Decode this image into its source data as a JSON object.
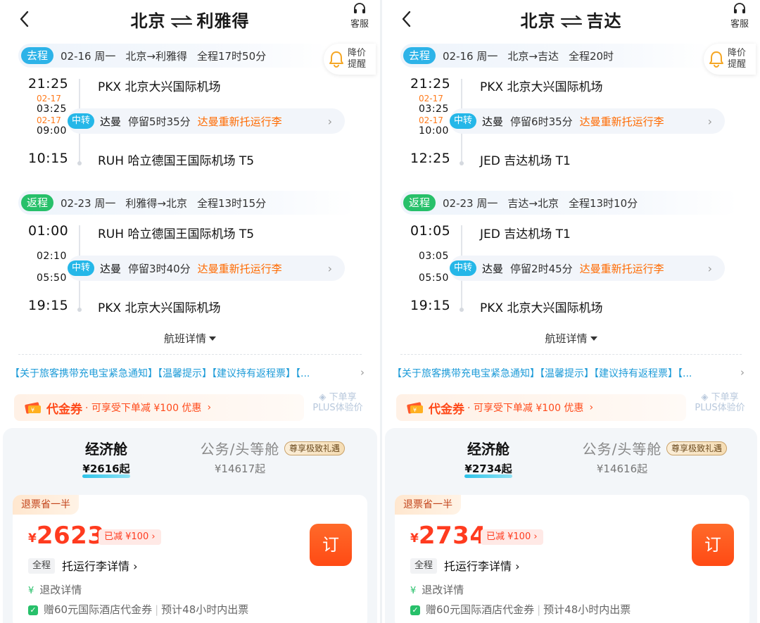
{
  "panels": [
    {
      "header": {
        "from": "北京",
        "to": "利雅得",
        "service_label": "客服"
      },
      "alert": {
        "label_line1": "降价",
        "label_line2": "提醒"
      },
      "outbound": {
        "tag": "去程",
        "date": "02-16 周一",
        "route": "北京→利雅得",
        "duration": "全程17时50分",
        "dep_time": "21:25",
        "dep_airport": "PKX 北京大兴国际机场",
        "arr1_date": "02-17",
        "arr1_time": "03:25",
        "dep2_date": "02-17",
        "dep2_time": "09:00",
        "arr_time": "10:15",
        "arr_airport": "RUH 哈立德国王国际机场 T5",
        "transfer": {
          "tag": "中转",
          "city": "达曼",
          "stay": "停留5时35分",
          "baggage": "达曼重新托运行李"
        }
      },
      "return": {
        "tag": "返程",
        "date": "02-23 周一",
        "route": "利雅得→北京",
        "duration": "全程13时15分",
        "dep_time": "01:00",
        "dep_airport": "RUH 哈立德国王国际机场 T5",
        "arr1_time": "02:10",
        "dep2_time": "05:50",
        "arr_time": "19:15",
        "arr_airport": "PKX 北京大兴国际机场",
        "transfer": {
          "tag": "中转",
          "city": "达曼",
          "stay": "停留3时40分",
          "baggage": "达曼重新托运行李"
        }
      },
      "flight_details": "航班详情",
      "notice": "【关于旅客携带充电宝紧急通知】【温馨提示】【建议持有返程票】【...",
      "coupon": {
        "name": "代金券",
        "desc": "· 可享受下单减 ¥100 优惠"
      },
      "plus": {
        "line1": "下单享",
        "line2": "PLUS体验价"
      },
      "cabins": {
        "economy": {
          "name": "经济舱",
          "price": "¥2616起"
        },
        "business": {
          "name": "公务/头等舱",
          "price": "¥14617起",
          "tag": "尊享极致礼遇"
        }
      },
      "offer": {
        "tag": "退票省一半",
        "currency": "¥",
        "price": "2623",
        "discount": "已减 ¥100",
        "book": "订",
        "whole_trip": "全程",
        "baggage_details": "托运行李详情",
        "refund_details": "退改详情",
        "hotel_voucher": "赠60元国际酒店代金券",
        "ticketing": "预计48小时内出票"
      }
    },
    {
      "header": {
        "from": "北京",
        "to": "吉达",
        "service_label": "客服"
      },
      "alert": {
        "label_line1": "降价",
        "label_line2": "提醒"
      },
      "outbound": {
        "tag": "去程",
        "date": "02-16 周一",
        "route": "北京→吉达",
        "duration": "全程20时",
        "dep_time": "21:25",
        "dep_airport": "PKX 北京大兴国际机场",
        "arr1_date": "02-17",
        "arr1_time": "03:25",
        "dep2_date": "02-17",
        "dep2_time": "10:00",
        "arr_time": "12:25",
        "arr_airport": "JED 吉达机场 T1",
        "transfer": {
          "tag": "中转",
          "city": "达曼",
          "stay": "停留6时35分",
          "baggage": "达曼重新托运行李"
        }
      },
      "return": {
        "tag": "返程",
        "date": "02-23 周一",
        "route": "吉达→北京",
        "duration": "全程13时10分",
        "dep_time": "01:05",
        "dep_airport": "JED 吉达机场 T1",
        "arr1_time": "03:05",
        "dep2_time": "05:50",
        "arr_time": "19:15",
        "arr_airport": "PKX 北京大兴国际机场",
        "transfer": {
          "tag": "中转",
          "city": "达曼",
          "stay": "停留2时45分",
          "baggage": "达曼重新托运行李"
        }
      },
      "flight_details": "航班详情",
      "notice": "【关于旅客携带充电宝紧急通知】【温馨提示】【建议持有返程票】【...",
      "coupon": {
        "name": "代金券",
        "desc": "· 可享受下单减 ¥100 优惠"
      },
      "plus": {
        "line1": "下单享",
        "line2": "PLUS体验价"
      },
      "cabins": {
        "economy": {
          "name": "经济舱",
          "price": "¥2734起"
        },
        "business": {
          "name": "公务/头等舱",
          "price": "¥14616起",
          "tag": "尊享极致礼遇"
        }
      },
      "offer": {
        "tag": "退票省一半",
        "currency": "¥",
        "price": "2734",
        "discount": "已减 ¥100",
        "book": "订",
        "whole_trip": "全程",
        "baggage_details": "托运行李详情",
        "refund_details": "退改详情",
        "hotel_voucher": "赠60元国际酒店代金券",
        "ticketing": "预计48小时内出票"
      }
    }
  ],
  "colors": {
    "outbound_tag": "#2db3e8",
    "return_tag": "#27c06a",
    "transfer_tag": "#25b7e8",
    "baggage_notice": "#ff6a00",
    "price": "#ff3b1f",
    "book_button": "#ff4a14",
    "notice_link": "#1d9bd8"
  },
  "icons": [
    "back-chevron-icon",
    "swap-arrows-icon",
    "headset-icon",
    "bell-icon",
    "chevron-right-icon",
    "dropdown-triangle-icon",
    "coupon-ticket-icon",
    "plus-badge-icon",
    "yen-icon",
    "check-icon"
  ]
}
